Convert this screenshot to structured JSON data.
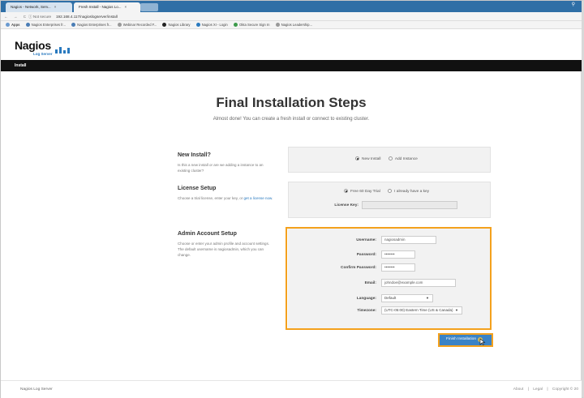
{
  "browser": {
    "tabs": [
      {
        "label": "Nagios - Network, Serv..."
      },
      {
        "label": "Fresh Install - Nagios Lo..."
      }
    ],
    "nav_icons": "← → C",
    "security_label": "ⓘ Not secure",
    "url": "192.168.4.117/nagioslogserver/install",
    "bookmarks": [
      {
        "label": "Apps"
      },
      {
        "label": "Nagios Enterprises fr..."
      },
      {
        "label": "Nagios Enterprises fr..."
      },
      {
        "label": "Webinar Recorded F..."
      },
      {
        "label": "Nagios Library"
      },
      {
        "label": "Nagios XI - Login"
      },
      {
        "label": "Okta Secure Sign In"
      },
      {
        "label": "Nagios Leadership..."
      }
    ]
  },
  "app": {
    "logo_text": "Nagios",
    "logo_sub": "Log Server",
    "nav_item": "Install"
  },
  "page": {
    "title": "Final Installation Steps",
    "subtitle": "Almost done! You can create a fresh install or connect to existing cluster."
  },
  "new_install": {
    "heading": "New Install?",
    "description": "Is this a new install or are we adding a instance to an existing cluster?",
    "options": [
      "New Install",
      "Add Instance"
    ],
    "selected": "New Install"
  },
  "license": {
    "heading": "License Setup",
    "description_prefix": "Choose a trial license, enter your key, or ",
    "description_link": "get a license now",
    "description_suffix": ".",
    "options": [
      "Free 60 Day Trial",
      "I already have a key"
    ],
    "selected": "Free 60 Day Trial",
    "key_label": "License Key:",
    "key_value": ""
  },
  "admin": {
    "heading": "Admin Account Setup",
    "description": "Choose or enter your admin profile and account settings. The default username is nagiosadmin, which you can change.",
    "username_label": "Username:",
    "username_value": "nagiosadmin",
    "password_label": "Password:",
    "password_value": "••••••••",
    "confirm_label": "Confirm Password:",
    "confirm_value": "••••••••",
    "email_label": "Email:",
    "email_value": "johndoe@example.com",
    "language_label": "Language:",
    "language_value": "Default",
    "timezone_label": "Timezone:",
    "timezone_value": "(UTC-05:00) Eastern Time (US & Canada)"
  },
  "actions": {
    "finish_label": "Finish Installation"
  },
  "footer": {
    "left": "Nagios Log Server",
    "about": "About",
    "legal": "Legal",
    "copyright": "Copyright © 20"
  },
  "colors": {
    "highlight": "#f4a11d",
    "primary": "#3a83c6",
    "navbar": "#111111"
  }
}
